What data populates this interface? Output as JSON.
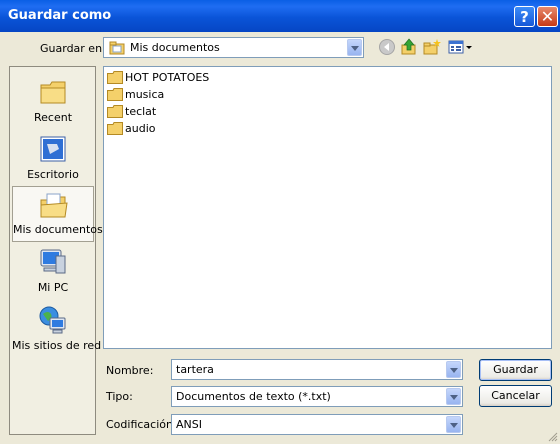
{
  "window": {
    "title": "Guardar como"
  },
  "save_in": {
    "label": "Guardar en:",
    "value": "Mis documentos"
  },
  "toolbar": {
    "back_icon": "back-icon",
    "up_icon": "up-folder-icon",
    "new_folder_icon": "new-folder-icon",
    "views_icon": "views-menu-icon"
  },
  "places": [
    {
      "label": "Recent",
      "icon": "recent-icon"
    },
    {
      "label": "Escritorio",
      "icon": "desktop-icon"
    },
    {
      "label": "Mis documentos",
      "icon": "my-documents-icon",
      "selected": true
    },
    {
      "label": "Mi PC",
      "icon": "my-computer-icon"
    },
    {
      "label": "Mis sitios de red",
      "icon": "network-places-icon"
    }
  ],
  "files": [
    {
      "name": "HOT POTATOES"
    },
    {
      "name": "musica"
    },
    {
      "name": "teclat"
    },
    {
      "name": "audio"
    }
  ],
  "fields": {
    "filename": {
      "label": "Nombre:",
      "value": "tartera"
    },
    "type": {
      "label": "Tipo:",
      "value": "Documentos de texto (*.txt)"
    },
    "encoding": {
      "label": "Codificación:",
      "value": "ANSI"
    }
  },
  "buttons": {
    "save": "Guardar",
    "cancel": "Cancelar"
  },
  "colors": {
    "titlebar": "#0a54d8",
    "dialog_bg": "#ece9d8",
    "folder": "#f4d06a"
  }
}
